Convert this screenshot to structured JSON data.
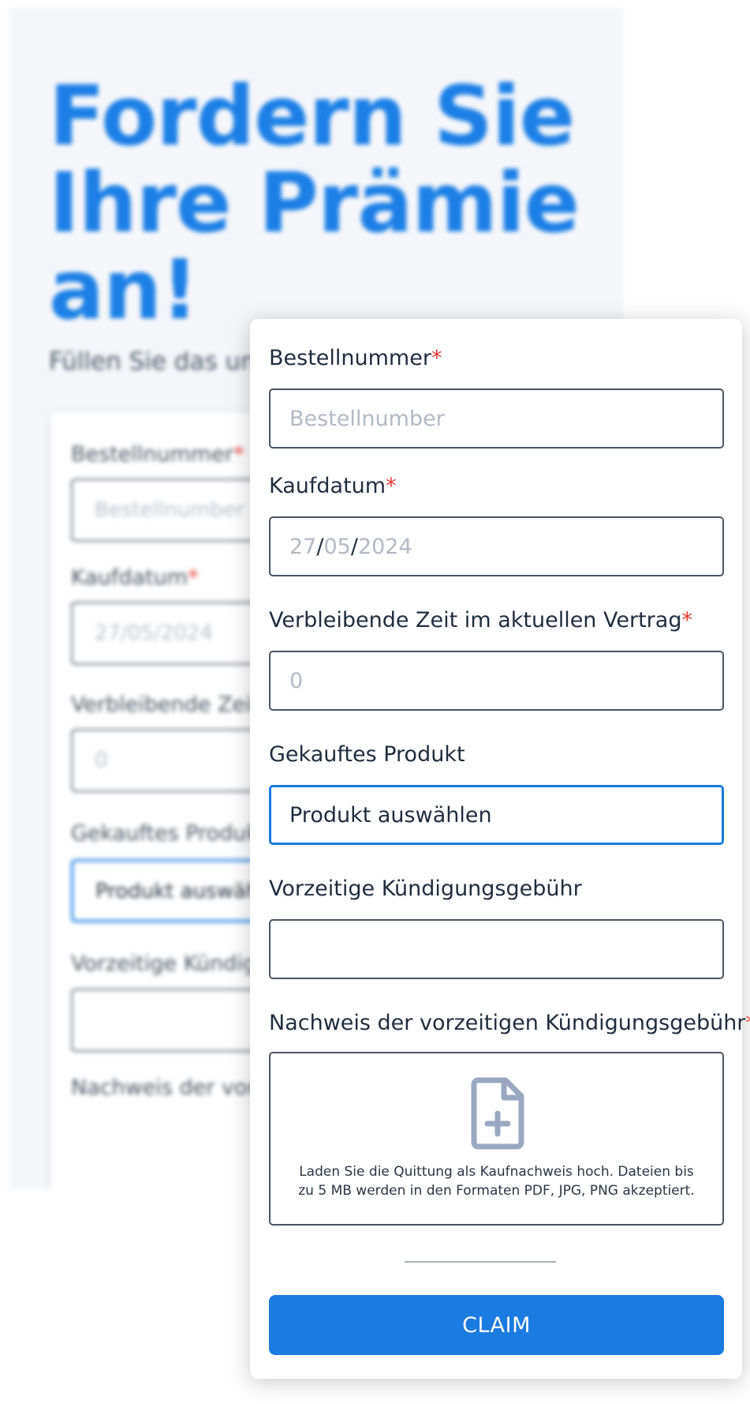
{
  "background": {
    "title": "Fordern Sie Ihre Prämie an!",
    "subtitle": "Füllen Sie das unt",
    "fields": [
      {
        "label": "Bestellnummer",
        "value": "Bestellnumber"
      },
      {
        "label": "Kaufdatum",
        "value": "27/05/2024"
      },
      {
        "label": "Verbleibende Zeit i",
        "value": "0"
      },
      {
        "label": "Gekauftes Produkt",
        "value": "Produkt auswäh"
      },
      {
        "label": "Vorzeitige Kündigu",
        "value": ""
      },
      {
        "label": "Nachweis der vorz"
      }
    ]
  },
  "form": {
    "order_number": {
      "label": "Bestellnummer",
      "placeholder": "Bestellnumber"
    },
    "purchase_date": {
      "label": "Kaufdatum",
      "day": "27",
      "month": "05",
      "year": "2024",
      "separator": "/"
    },
    "remaining_time": {
      "label": "Verbleibende Zeit im aktuellen Vertrag",
      "placeholder": "0"
    },
    "product": {
      "label": "Gekauftes Produkt",
      "value": "Produkt auswählen"
    },
    "early_fee": {
      "label": "Vorzeitige Kündigungsgebühr",
      "value": ""
    },
    "proof": {
      "label": "Nachweis der vorzeitigen Kündigungsgebühr",
      "help_text": "Laden Sie die Quittung als Kaufnachweis hoch. Dateien bis zu 5 MB werden in den Formaten PDF, JPG, PNG akzeptiert.",
      "icon": "file-plus-icon"
    },
    "required_marker": "*",
    "submit_label": "CLAIM"
  },
  "colors": {
    "accent": "#1a7be0",
    "required": "#e53935",
    "icon": "#9aa8bf"
  }
}
